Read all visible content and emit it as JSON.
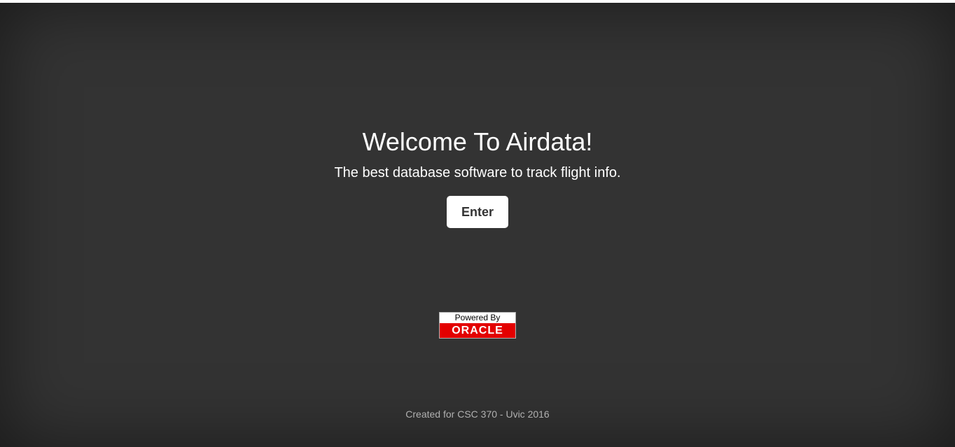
{
  "welcome": {
    "title": "Welcome To Airdata!",
    "subtitle": "The best database software to track flight info.",
    "enter_label": "Enter"
  },
  "badge": {
    "top_text": "Powered By",
    "brand_text": "ORACLE",
    "brand_color": "#e30000"
  },
  "footer": {
    "text": "Created for CSC 370 - Uvic 2016"
  },
  "colors": {
    "background": "#333333",
    "text": "#ffffff",
    "button_bg": "#ffffff",
    "button_text": "#333333",
    "footer_text": "#b0b0b0"
  }
}
